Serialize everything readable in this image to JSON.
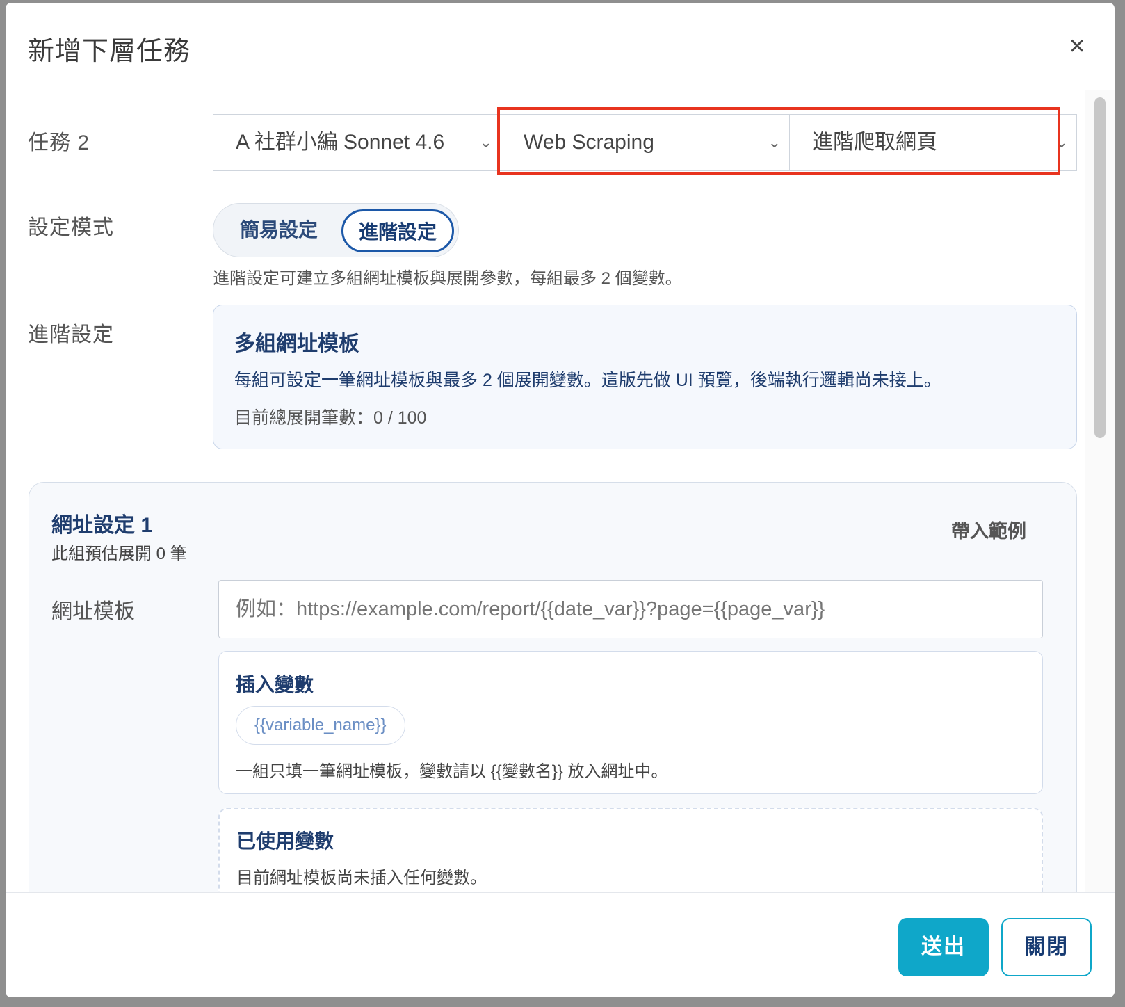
{
  "modal": {
    "title": "新增下層任務",
    "close_icon": "×"
  },
  "task": {
    "label": "任務 2",
    "agent_select": "A 社群小編 Sonnet 4.6",
    "category_select": "Web Scraping",
    "action_select": "進階爬取網頁",
    "highlight_color": "#e8341f"
  },
  "mode": {
    "label": "設定模式",
    "simple": "簡易設定",
    "advanced": "進階設定",
    "selected": "進階設定",
    "hint": "進階設定可建立多組網址模板與展開參數，每組最多 2 個變數。"
  },
  "advanced": {
    "label": "進階設定",
    "title": "多組網址模板",
    "description": "每組可設定一筆網址模板與最多 2 個展開變數。這版先做 UI 預覽，後端執行邏輯尚未接上。",
    "total_count": "目前總展開筆數：0 / 100"
  },
  "url_group": {
    "title": "網址設定 1",
    "subtitle": "此組預估展開 0 筆",
    "example_button": "帶入範例",
    "template_label": "網址模板",
    "template_value": "",
    "template_placeholder": "例如：https://example.com/report/{{date_var}}?page={{page_var}}",
    "insert_title": "插入變數",
    "insert_chip": "{{variable_name}}",
    "insert_note": "一組只填一筆網址模板，變數請以 {{變數名}} 放入網址中。",
    "used_title": "已使用變數",
    "used_note": "目前網址模板尚未插入任何變數。"
  },
  "footer": {
    "submit": "送出",
    "close": "關閉"
  },
  "colors": {
    "accent": "#0fa7c9",
    "navy": "#1f3d6e",
    "toggle_active_border": "#1c58a8"
  }
}
